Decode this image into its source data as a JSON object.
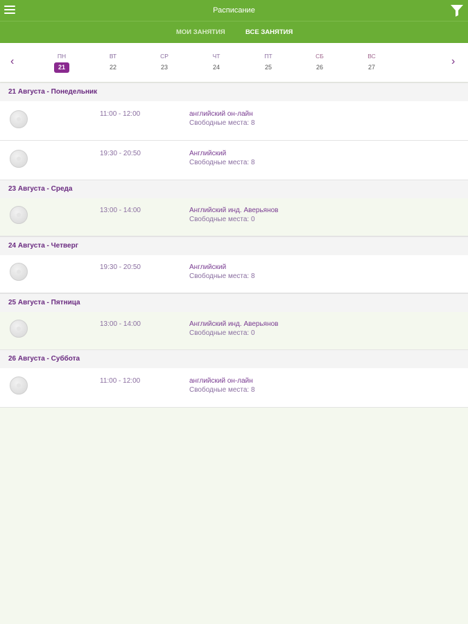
{
  "header": {
    "title": "Расписание"
  },
  "tabs": {
    "my": "мои занятия",
    "all": "все занятия"
  },
  "week": {
    "days": [
      {
        "dow": "ПН",
        "num": "21"
      },
      {
        "dow": "ВТ",
        "num": "22"
      },
      {
        "dow": "СР",
        "num": "23"
      },
      {
        "dow": "ЧТ",
        "num": "24"
      },
      {
        "dow": "ПТ",
        "num": "25"
      },
      {
        "dow": "СБ",
        "num": "26"
      },
      {
        "dow": "ВС",
        "num": "27"
      }
    ],
    "prev_icon": "chevron-left-icon",
    "next_icon": "chevron-right-icon"
  },
  "sections": [
    {
      "title": "21 Августа - Понедельник",
      "lessons": [
        {
          "time": "11:00 - 12:00",
          "course": "английский он-лайн",
          "seats": "Свободные места: 8"
        },
        {
          "time": "19:30 - 20:50",
          "course": "Английский",
          "seats": "Свободные места: 8"
        }
      ]
    },
    {
      "title": "23 Августа - Среда",
      "lessons": [
        {
          "time": "13:00 - 14:00",
          "course": "Английский инд. Аверьянов",
          "seats": "Свободные места: 0"
        }
      ]
    },
    {
      "title": "24 Августа - Четверг",
      "lessons": [
        {
          "time": "19:30 - 20:50",
          "course": "Английский",
          "seats": "Свободные места: 8"
        }
      ]
    },
    {
      "title": "25 Августа - Пятница",
      "lessons": [
        {
          "time": "13:00 - 14:00",
          "course": "Английский инд. Аверьянов",
          "seats": "Свободные места: 0"
        }
      ]
    },
    {
      "title": "26 Августа - Суббота",
      "lessons": [
        {
          "time": "11:00 - 12:00",
          "course": "английский он-лайн",
          "seats": "Свободные места: 8"
        }
      ]
    }
  ],
  "colors": {
    "brand_green": "#6aae35",
    "accent_purple": "#8a2a8f"
  }
}
